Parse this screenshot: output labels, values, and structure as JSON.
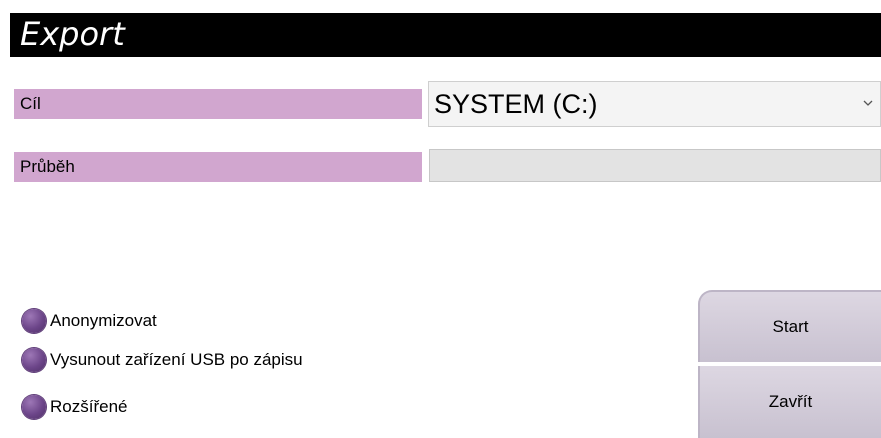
{
  "dialog": {
    "title": "Export"
  },
  "target": {
    "label": "Cíl",
    "selected": "SYSTEM (C:)"
  },
  "progress": {
    "label": "Průběh",
    "fraction": 0
  },
  "options": [
    {
      "label": "Anonymizovat"
    },
    {
      "label": "Vysunout zařízení USB po zápisu"
    },
    {
      "label": "Rozšířené"
    }
  ],
  "buttons": {
    "start": "Start",
    "close": "Zavřít"
  },
  "icons": {
    "dropdown": "chevron-down-icon",
    "radio": "radio-button-icon"
  },
  "colors": {
    "title_bar": "#000000",
    "label_background": "#d1a6cf",
    "radio": "#6c4589",
    "button": "#d3ccda"
  }
}
